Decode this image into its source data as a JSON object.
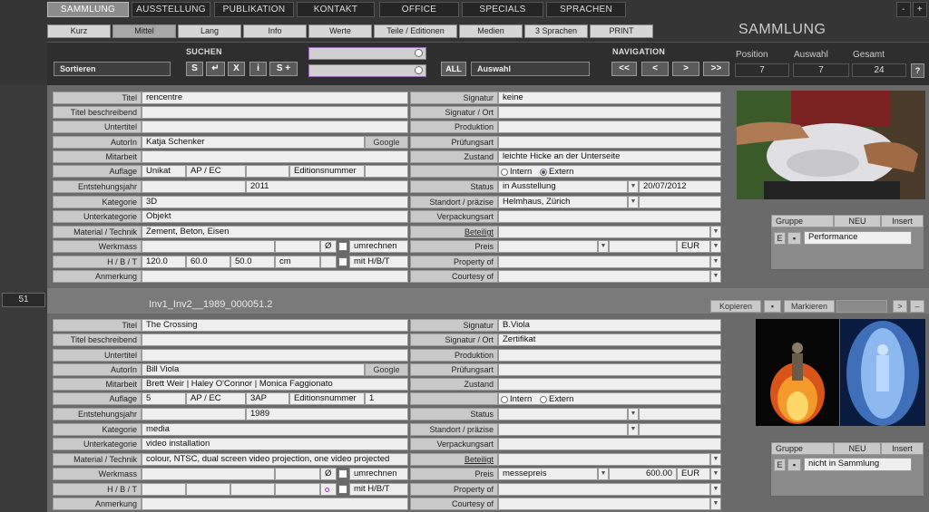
{
  "top_nav": [
    "SAMMLUNG",
    "AUSSTELLUNG",
    "PUBLIKATION",
    "KONTAKT",
    "OFFICE",
    "SPECIALS",
    "SPRACHEN"
  ],
  "window_buttons": {
    "minus": "-",
    "plus": "+"
  },
  "view_tabs": [
    "Kurz",
    "Mittel",
    "Lang",
    "Info",
    "Werte",
    "Teile / Editionen",
    "Medien",
    "3 Sprachen",
    "PRINT"
  ],
  "section_title": "SAMMLUNG",
  "toolbar": {
    "sort_label": "Sortieren",
    "search_label": "SUCHEN",
    "search_buttons": [
      "S",
      "↵",
      "X",
      "i",
      "S +"
    ],
    "all_label": "ALL",
    "auswahl_label": "Auswahl",
    "nav_label": "NAVIGATION",
    "nav_buttons": [
      "<<",
      "<",
      ">",
      ">>"
    ],
    "position_label": "Position",
    "position_value": "7",
    "auswahl_count_label": "Auswahl",
    "auswahl_count_value": "7",
    "gesamt_label": "Gesamt",
    "gesamt_value": "24",
    "help_label": "?"
  },
  "labels": {
    "titel": "Titel",
    "titel_beschreibend": "Titel beschreibend",
    "untertitel": "Untertitel",
    "autorin": "AutorIn",
    "mitarbeit": "Mitarbeit",
    "auflage": "Auflage",
    "entstehungsjahr": "Entstehungsjahr",
    "kategorie": "Kategorie",
    "unterkategorie": "Unterkategorie",
    "material": "Material / Technik",
    "werkmass": "Werkmass",
    "hbt": "H / B / T",
    "anmerkung": "Anmerkung",
    "signatur": "Signatur",
    "signatur_ort": "Signatur / Ort",
    "produktion": "Produktion",
    "pruefungsart": "Prüfungsart",
    "zustand": "Zustand",
    "status": "Status",
    "standort": "Standort / präzise",
    "verpackungsart": "Verpackungsart",
    "beteiligt": "Beteiligt",
    "preis": "Preis",
    "property_of": "Property of",
    "courtesy_of": "Courtesy of",
    "google": "Google",
    "ap_ec": "AP / EC",
    "editionsnummer": "Editionsnummer",
    "diameter": "Ø",
    "umrechnen": "umrechnen",
    "mit_hbt": "mit H/B/T",
    "intern": "Intern",
    "extern": "Extern",
    "gruppe": "Gruppe",
    "neu": "NEU",
    "insert": "Insert",
    "e_btn": "E"
  },
  "record1": {
    "titel": "rencentre",
    "autorin": "Katja Schenker",
    "auflage": "Unikat",
    "ap_ec_value": "",
    "editionsnummer_value": "",
    "entstehungsjahr": "2011",
    "kategorie": "3D",
    "unterkategorie": "Objekt",
    "material": "Zement, Beton, Eisen",
    "h": "120.0",
    "b": "60.0",
    "t": "50.0",
    "unit": "cm",
    "signatur": "keine",
    "zustand": "leichte Hicke an der Unterseite",
    "status": "in Ausstellung",
    "status_date": "20/07/2012",
    "standort": "Helmhaus, Zürich",
    "preis_currency": "EUR",
    "radio_selected": "extern",
    "gruppe_value": "Performance"
  },
  "record2": {
    "number": "51",
    "inventory": "Inv1_Inv2__1989_000051.2",
    "kopieren": "Kopieren",
    "markieren": "Markieren",
    "next": ">",
    "minus": "–",
    "titel": "The Crossing",
    "autorin": "Bill Viola",
    "mitarbeit": "Brett Weir | Haley O'Connor | Monica Faggionato",
    "auflage": "5",
    "ap_ec_value": "3AP",
    "editionsnummer_value": "1",
    "entstehungsjahr": "1989",
    "kategorie": "media",
    "unterkategorie": "video installation",
    "material": "colour, NTSC, dual screen video projection, one video projected",
    "signatur": "B.Viola",
    "signatur_ort": "Zertifikat",
    "preis": "messepreis",
    "preis_value": "600.00",
    "preis_currency": "EUR",
    "gruppe_value": "nicht in Sammlung"
  }
}
